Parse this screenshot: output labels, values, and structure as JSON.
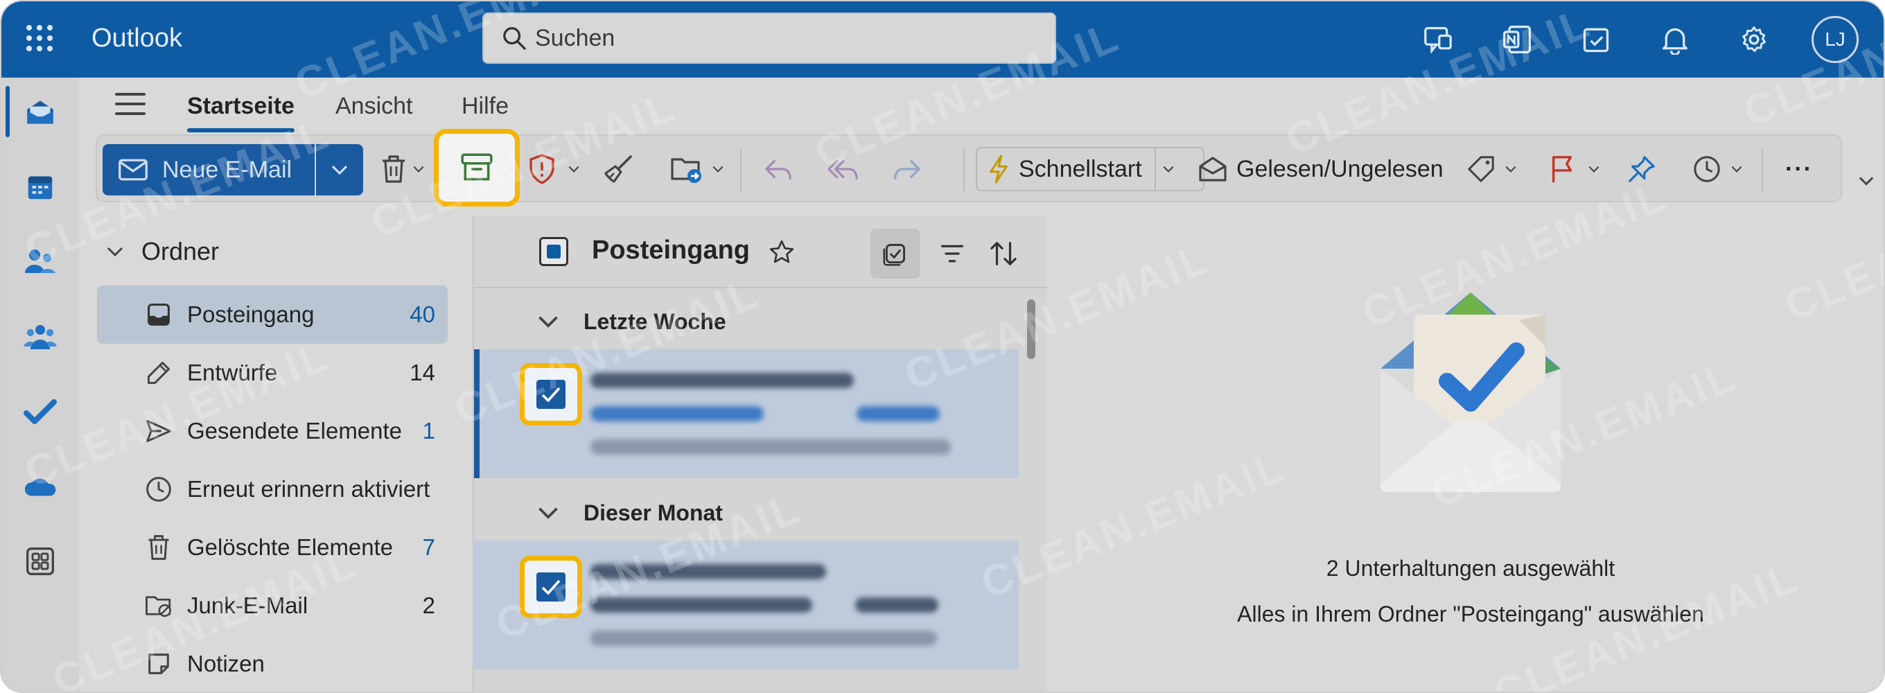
{
  "app": {
    "title": "Outlook",
    "avatar_initials": "LJ"
  },
  "search": {
    "placeholder": "Suchen"
  },
  "tabs": [
    {
      "label": "Startseite",
      "active": true
    },
    {
      "label": "Ansicht",
      "active": false
    },
    {
      "label": "Hilfe",
      "active": false
    }
  ],
  "ribbon": {
    "new_mail": "Neue E-Mail",
    "quick_steps": "Schnellstart",
    "read_unread": "Gelesen/Ungelesen",
    "more": "···"
  },
  "folders": {
    "header": "Ordner",
    "items": [
      {
        "label": "Posteingang",
        "count": "40",
        "selected": true
      },
      {
        "label": "Entwürfe",
        "count": "14",
        "selected": false
      },
      {
        "label": "Gesendete Elemente",
        "count": "1",
        "selected": false
      },
      {
        "label": "Erneut erinnern aktiviert",
        "count": "",
        "selected": false
      },
      {
        "label": "Gelöschte Elemente",
        "count": "7",
        "selected": false
      },
      {
        "label": "Junk-E-Mail",
        "count": "2",
        "selected": false
      },
      {
        "label": "Notizen",
        "count": "",
        "selected": false
      }
    ]
  },
  "message_list": {
    "title": "Posteingang",
    "groups": [
      {
        "label": "Letzte Woche"
      },
      {
        "label": "Dieser Monat"
      }
    ]
  },
  "reading_pane": {
    "selected_count": "2 Unterhaltungen ausgewählt",
    "select_all": "Alles in Ihrem Ordner \"Posteingang\" auswählen"
  },
  "watermark": "CLEAN.EMAIL",
  "colors": {
    "brand": "#0f5ba3",
    "highlight": "#f5b400",
    "delete_red": "#c0392b"
  }
}
